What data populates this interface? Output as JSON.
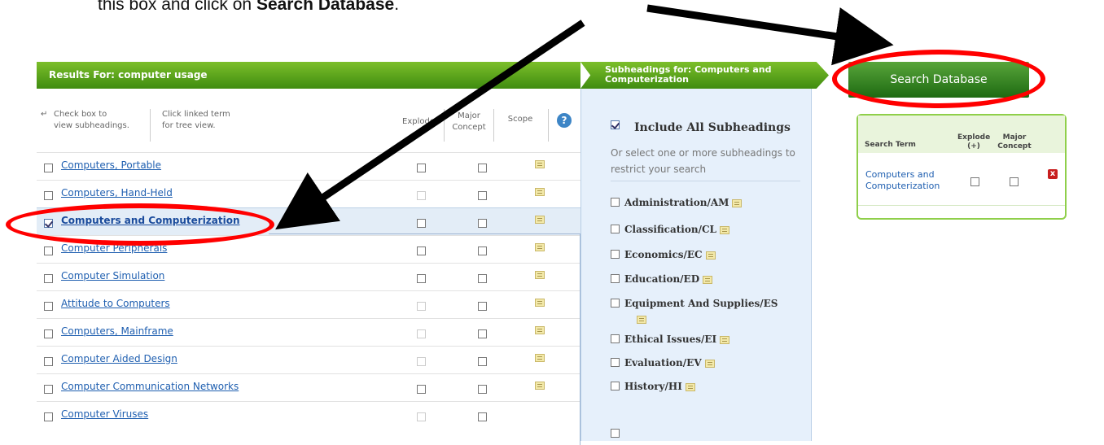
{
  "instruction": {
    "prefix": "this box and click on ",
    "bold": "Search Database",
    "suffix": "."
  },
  "results": {
    "header": "Results For: computer usage",
    "hint_check": "Check box to\nview subheadings.",
    "hint_click": "Click linked term\nfor tree view.",
    "col_explode": "Explode",
    "col_major": "Major\nConcept",
    "col_scope": "Scope",
    "help_icon": "?",
    "rows": [
      {
        "term": "Computers, Portable",
        "checked": false,
        "explode_faint": false,
        "scope": true
      },
      {
        "term": "Computers, Hand-Held",
        "checked": false,
        "explode_faint": true,
        "scope": true
      },
      {
        "term": "Computers and Computerization",
        "checked": true,
        "explode_faint": false,
        "scope": true
      },
      {
        "term": "Computer Peripherals",
        "checked": false,
        "explode_faint": false,
        "scope": true
      },
      {
        "term": "Computer Simulation",
        "checked": false,
        "explode_faint": false,
        "scope": true
      },
      {
        "term": "Attitude to Computers",
        "checked": false,
        "explode_faint": true,
        "scope": true
      },
      {
        "term": "Computers, Mainframe",
        "checked": false,
        "explode_faint": true,
        "scope": true
      },
      {
        "term": "Computer Aided Design",
        "checked": false,
        "explode_faint": true,
        "scope": true
      },
      {
        "term": "Computer Communication Networks",
        "checked": false,
        "explode_faint": false,
        "scope": true
      },
      {
        "term": "Computer Viruses",
        "checked": false,
        "explode_faint": true,
        "scope": false
      }
    ]
  },
  "subheadings": {
    "header": "Subheadings for: Computers and Computerization",
    "include_all": "Include All Subheadings",
    "hint": "Or select one or more subheadings to restrict your search",
    "items": [
      "Administration/AM",
      "Classification/CL",
      "Economics/EC",
      "Education/ED",
      "Equipment And Supplies/ES",
      "Ethical Issues/EI",
      "Evaluation/EV",
      "History/HI"
    ]
  },
  "right": {
    "search_button": "Search Database",
    "col_term": "Search Term",
    "col_explode": "Explode\n(+)",
    "col_major": "Major\nConcept",
    "selected_term": "Computers and\nComputerization",
    "remove_icon": "x"
  },
  "colors": {
    "accent_green": "#4f9a19",
    "link_blue": "#1f5fb0",
    "annotation_red": "#ff0000",
    "panel_blue": "#e6f0fb"
  }
}
